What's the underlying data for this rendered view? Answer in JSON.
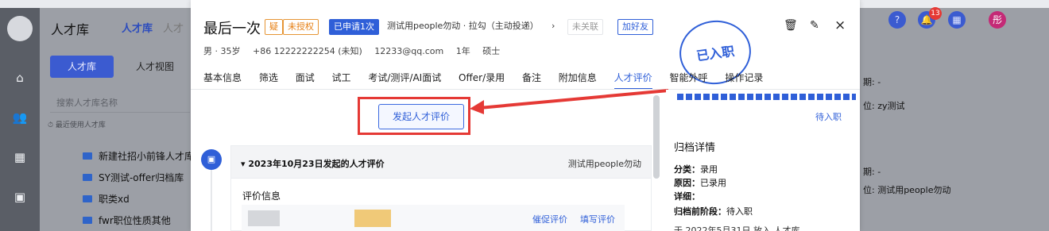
{
  "header": {
    "lp_title": "人才库",
    "lp_tab": "人才库",
    "lp_tab_partial": "人才"
  },
  "left_panel": {
    "tabs": [
      "人才库",
      "人才视图"
    ],
    "search_placeholder": "搜索人才库名称",
    "recent_label": "最近使用人才库",
    "folders": [
      "新建社招小前锋人才库",
      "SY测试-offer归档库",
      "职类xd",
      "fwr职位性质其他"
    ]
  },
  "candidate": {
    "name": "最后一次",
    "tags": [
      "疑",
      "未授权",
      "已申请1次"
    ],
    "job_info": "测试用people勿动 · 拉勾（主动投递）",
    "unlink": "未关联",
    "add_friend": "加好友",
    "meta": [
      "男 · 35岁",
      "+86 12222222254 (未知)",
      "12233@qq.com",
      "1年",
      "硕士"
    ],
    "tabs": [
      "基本信息",
      "筛选",
      "面试",
      "试工",
      "考试/测评/AI面试",
      "Offer/录用",
      "备注",
      "附加信息",
      "人才评价",
      "智能外呼",
      "操作记录"
    ],
    "active_tab": "人才评价"
  },
  "evaluation": {
    "start_button": "发起人才评价",
    "card_title": "2023年10月23日发起的人才评价",
    "card_owner": "测试用people勿动",
    "section_label": "评价信息",
    "actions": [
      "催促评价",
      "填写评价"
    ]
  },
  "archive": {
    "status": "待入职",
    "title": "归档详情",
    "category_label": "分类",
    "category_value": "录用",
    "reason_label": "原因",
    "reason_value": "已录用",
    "detail_label": "详细",
    "stage_label": "归档前阶段",
    "stage_value": "待入职",
    "footer_text": "于 2022年5月31日 放入 人才库"
  },
  "stamp": {
    "text": "已入职"
  },
  "right_bg": {
    "line1": "期: -",
    "line2": "位: zy测试",
    "line3": "期: -",
    "line4": "位: 测试用people勿动"
  },
  "top_right": {
    "badge": "13",
    "avatar": "彤"
  }
}
